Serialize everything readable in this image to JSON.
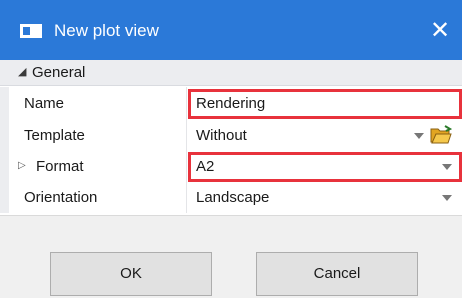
{
  "window": {
    "title": "New plot view",
    "close_label": "✕"
  },
  "section": {
    "label": "General",
    "collapse_glyph": "◢"
  },
  "properties": [
    {
      "name": "Name",
      "value": "Rendering",
      "editor": "text",
      "highlighted": true
    },
    {
      "name": "Template",
      "value": "Without",
      "editor": "dropdown",
      "extra_icon": "folder-open-icon",
      "highlighted": false
    },
    {
      "name": "Format",
      "value": "A2",
      "editor": "dropdown",
      "expandable": true,
      "highlighted": true
    },
    {
      "name": "Orientation",
      "value": "Landscape",
      "editor": "dropdown",
      "highlighted": false
    }
  ],
  "buttons": {
    "ok_label": "OK",
    "cancel_label": "Cancel"
  },
  "colors": {
    "title_bar": "#2b79d8",
    "highlight_border": "#e8323c"
  }
}
